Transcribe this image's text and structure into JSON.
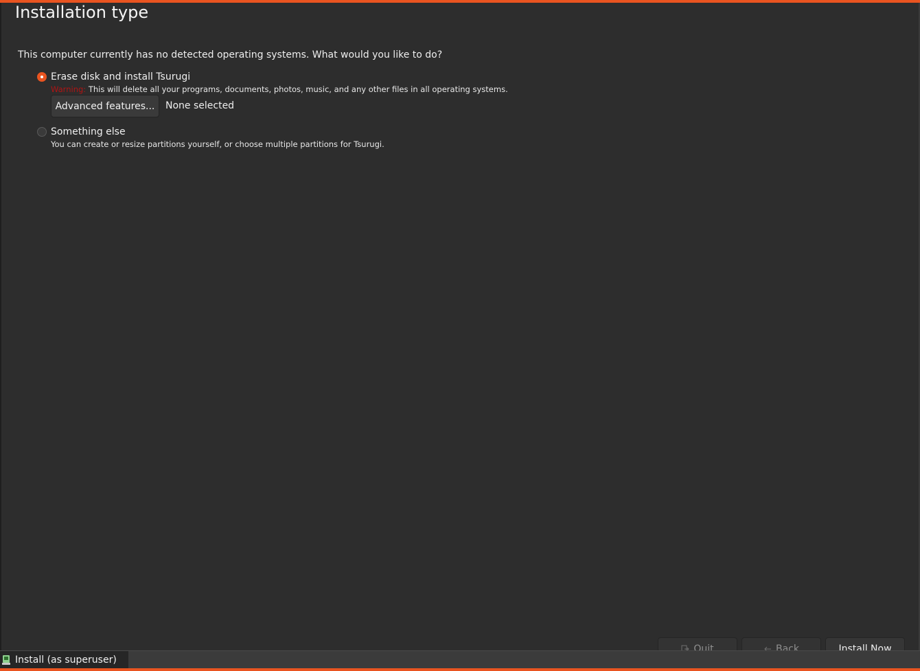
{
  "header": {
    "title": "Installation type"
  },
  "main": {
    "question": "This computer currently has no detected operating systems. What would you like to do?",
    "options": [
      {
        "label": "Erase disk and install Tsurugi",
        "selected": true,
        "warning_word": "Warning:",
        "hint": "This will delete all your programs, documents, photos, music, and any other files in all operating systems."
      },
      {
        "label": "Something else",
        "selected": false,
        "hint": "You can create or resize partitions yourself, or choose multiple partitions for Tsurugi."
      }
    ],
    "advanced_button": "Advanced features...",
    "advanced_status": "None selected"
  },
  "footer": {
    "quit_label": "Quit",
    "back_label": "Back",
    "install_label": "Install Now"
  },
  "taskbar": {
    "item_label": "Install (as superuser)"
  },
  "colors": {
    "accent": "#e95420",
    "warning": "#b01414",
    "background": "#2d2d2d"
  },
  "icons": {
    "quit": "exit-icon",
    "back": "arrow-left-icon",
    "taskbar": "installer-icon"
  }
}
